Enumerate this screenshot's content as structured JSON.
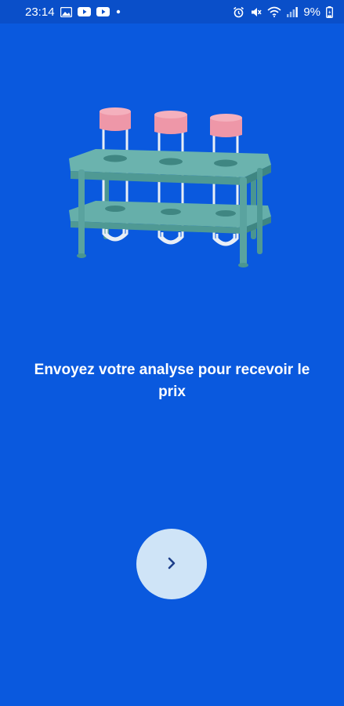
{
  "status_bar": {
    "time": "23:14",
    "battery": "9%",
    "left_icons": [
      "image-icon",
      "youtube-icon",
      "youtube-icon",
      "dot-icon"
    ],
    "right_icons": [
      "alarm-icon",
      "mute-icon",
      "wifi-icon",
      "signal-icon",
      "battery-icon"
    ]
  },
  "onboarding": {
    "illustration": "test-tubes-rack-illustration",
    "headline": "Envoyez votre analyse pour recevoir le prix",
    "next_button_icon": "chevron-right-icon"
  },
  "colors": {
    "background": "#0a59de",
    "button": "#cfe4f7",
    "rack": "#5ba7a3",
    "caps": "#ee97a8"
  }
}
